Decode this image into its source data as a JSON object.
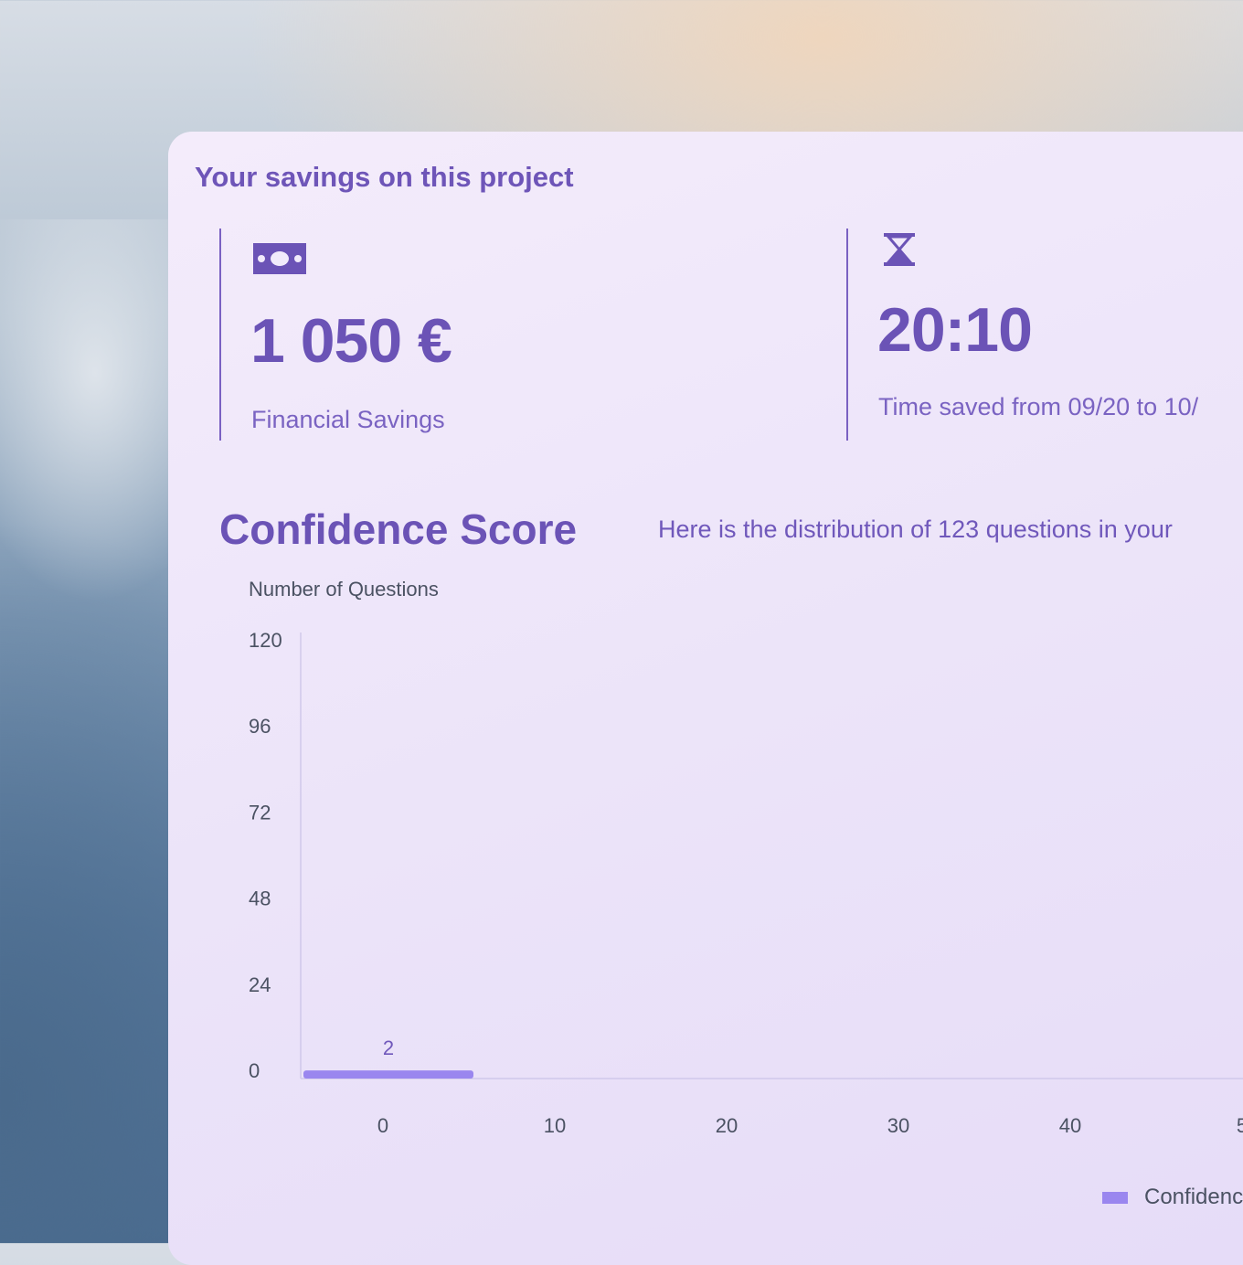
{
  "card": {
    "title": "Your savings on this project"
  },
  "financial": {
    "icon": "money-bill-icon",
    "value": "1 050 €",
    "label": "Financial Savings"
  },
  "time": {
    "icon": "hourglass-icon",
    "value": "20:10",
    "label": "Time saved from 09/20 to 10/"
  },
  "confidence": {
    "title": "Confidence Score",
    "description": "Here is the distribution of 123 questions in your"
  },
  "colors": {
    "accent": "#6b53b6",
    "bar": "#9a86ef",
    "bar_label": "#7058bb"
  },
  "chart_data": {
    "type": "bar",
    "ylabel": "Number of Questions",
    "ylim": [
      0,
      120
    ],
    "yticks": [
      "120",
      "96",
      "72",
      "48",
      "24",
      "0"
    ],
    "xticks": [
      "0",
      "10",
      "20",
      "30",
      "40",
      "5"
    ],
    "categories": [
      "0"
    ],
    "values": [
      2
    ],
    "data_labels": [
      "2"
    ],
    "legend": [
      "Confidenc"
    ],
    "legend_position": "bottom-right"
  }
}
